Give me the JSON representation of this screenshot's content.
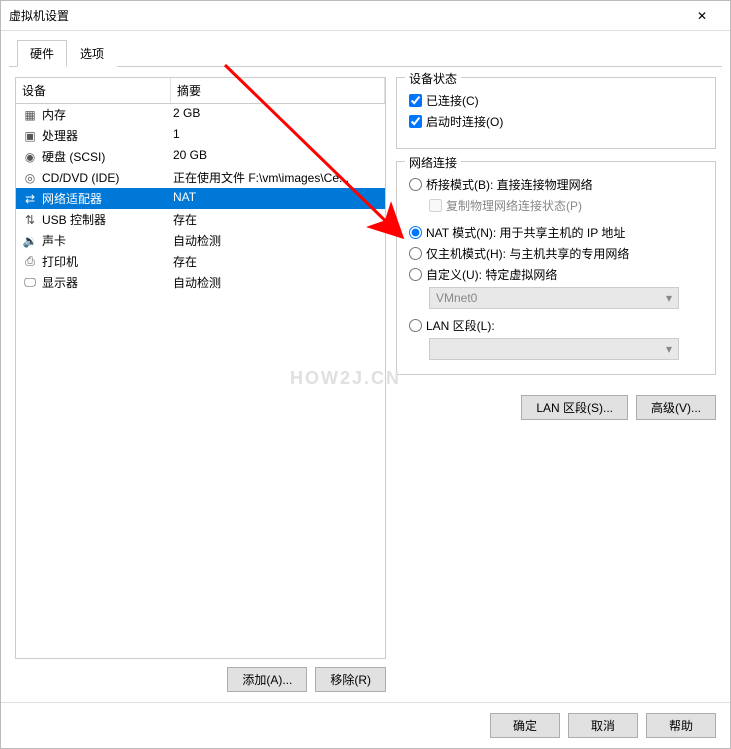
{
  "title": "虚拟机设置",
  "tabs": {
    "hardware": "硬件",
    "options": "选项"
  },
  "headers": {
    "device": "设备",
    "summary": "摘要"
  },
  "devices": [
    {
      "name": "内存",
      "summary": "2 GB",
      "icon": "memory"
    },
    {
      "name": "处理器",
      "summary": "1",
      "icon": "cpu"
    },
    {
      "name": "硬盘 (SCSI)",
      "summary": "20 GB",
      "icon": "disk"
    },
    {
      "name": "CD/DVD (IDE)",
      "summary": "正在使用文件 F:\\vm\\images\\Ce...",
      "icon": "cd"
    },
    {
      "name": "网络适配器",
      "summary": "NAT",
      "icon": "net",
      "selected": true
    },
    {
      "name": "USB 控制器",
      "summary": "存在",
      "icon": "usb"
    },
    {
      "name": "声卡",
      "summary": "自动检测",
      "icon": "sound"
    },
    {
      "name": "打印机",
      "summary": "存在",
      "icon": "printer"
    },
    {
      "name": "显示器",
      "summary": "自动检测",
      "icon": "display"
    }
  ],
  "left_buttons": {
    "add": "添加(A)...",
    "remove": "移除(R)"
  },
  "device_status": {
    "title": "设备状态",
    "connected": "已连接(C)",
    "connect_on": "启动时连接(O)"
  },
  "network": {
    "title": "网络连接",
    "bridged": "桥接模式(B): 直接连接物理网络",
    "replicate": "复制物理网络连接状态(P)",
    "nat": "NAT 模式(N): 用于共享主机的 IP 地址",
    "hostonly": "仅主机模式(H): 与主机共享的专用网络",
    "custom": "自定义(U): 特定虚拟网络",
    "custom_value": "VMnet0",
    "lan": "LAN 区段(L):"
  },
  "right_buttons": {
    "lan_segments": "LAN 区段(S)...",
    "advanced": "高级(V)..."
  },
  "footer": {
    "ok": "确定",
    "cancel": "取消",
    "help": "帮助"
  },
  "watermark": "HOW2J.CN"
}
